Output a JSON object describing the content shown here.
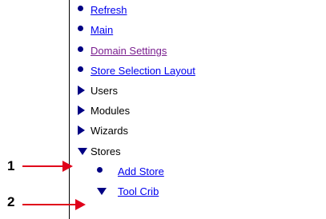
{
  "nav": {
    "items": [
      {
        "label": "Refresh",
        "type": "link",
        "icon": "bullet"
      },
      {
        "label": "Main",
        "type": "link",
        "icon": "bullet"
      },
      {
        "label": "Domain Settings",
        "type": "visited-link",
        "icon": "bullet"
      },
      {
        "label": "Store Selection Layout",
        "type": "link",
        "icon": "bullet"
      },
      {
        "label": "Users",
        "type": "folder",
        "icon": "collapsed-triangle"
      },
      {
        "label": "Modules",
        "type": "folder",
        "icon": "collapsed-triangle"
      },
      {
        "label": "Wizards",
        "type": "folder",
        "icon": "collapsed-triangle"
      },
      {
        "label": "Stores",
        "type": "folder",
        "icon": "expanded-triangle"
      },
      {
        "label": "Add Store",
        "type": "link",
        "icon": "bullet"
      },
      {
        "label": "Tool Crib",
        "type": "link",
        "icon": "expanded-triangle"
      }
    ]
  },
  "callouts": [
    {
      "label": "1"
    },
    {
      "label": "2"
    }
  ],
  "colors": {
    "link": "#0000ee",
    "visited_link": "#7a1f8f",
    "icon": "#000083",
    "callout_arrow": "#e0001a"
  }
}
